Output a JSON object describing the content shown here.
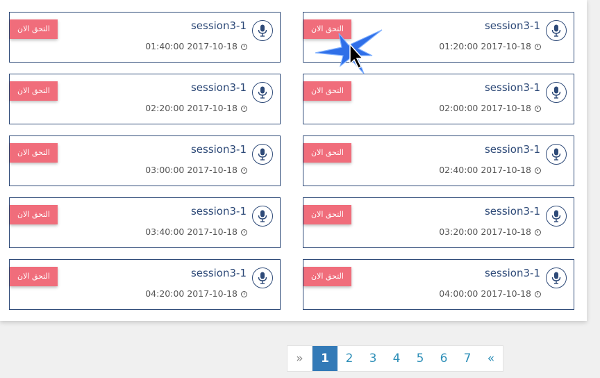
{
  "cards": [
    {
      "title": "session3-1",
      "datetime": "01:40:00 2017-10-18",
      "button": "التحق الان"
    },
    {
      "title": "session3-1",
      "datetime": "01:20:00 2017-10-18",
      "button": "التحق الان"
    },
    {
      "title": "session3-1",
      "datetime": "02:20:00 2017-10-18",
      "button": "التحق الان"
    },
    {
      "title": "session3-1",
      "datetime": "02:00:00 2017-10-18",
      "button": "التحق الان"
    },
    {
      "title": "session3-1",
      "datetime": "03:00:00 2017-10-18",
      "button": "التحق الان"
    },
    {
      "title": "session3-1",
      "datetime": "02:40:00 2017-10-18",
      "button": "التحق الان"
    },
    {
      "title": "session3-1",
      "datetime": "03:40:00 2017-10-18",
      "button": "التحق الان"
    },
    {
      "title": "session3-1",
      "datetime": "03:20:00 2017-10-18",
      "button": "التحق الان"
    },
    {
      "title": "session3-1",
      "datetime": "04:20:00 2017-10-18",
      "button": "التحق الان"
    },
    {
      "title": "session3-1",
      "datetime": "04:00:00 2017-10-18",
      "button": "التحق الان"
    }
  ],
  "pagination": {
    "prev": "»",
    "pages": [
      "1",
      "2",
      "3",
      "4",
      "5",
      "6",
      "7"
    ],
    "next": "«",
    "active_page": "1"
  },
  "colors": {
    "accent": "#f06d7b",
    "border": "#2e4a78",
    "active_page": "#337ab7",
    "page_link": "#2e8fb8"
  },
  "icons": {
    "card_icon": "microphone-icon",
    "time_icon": "clock-icon"
  }
}
